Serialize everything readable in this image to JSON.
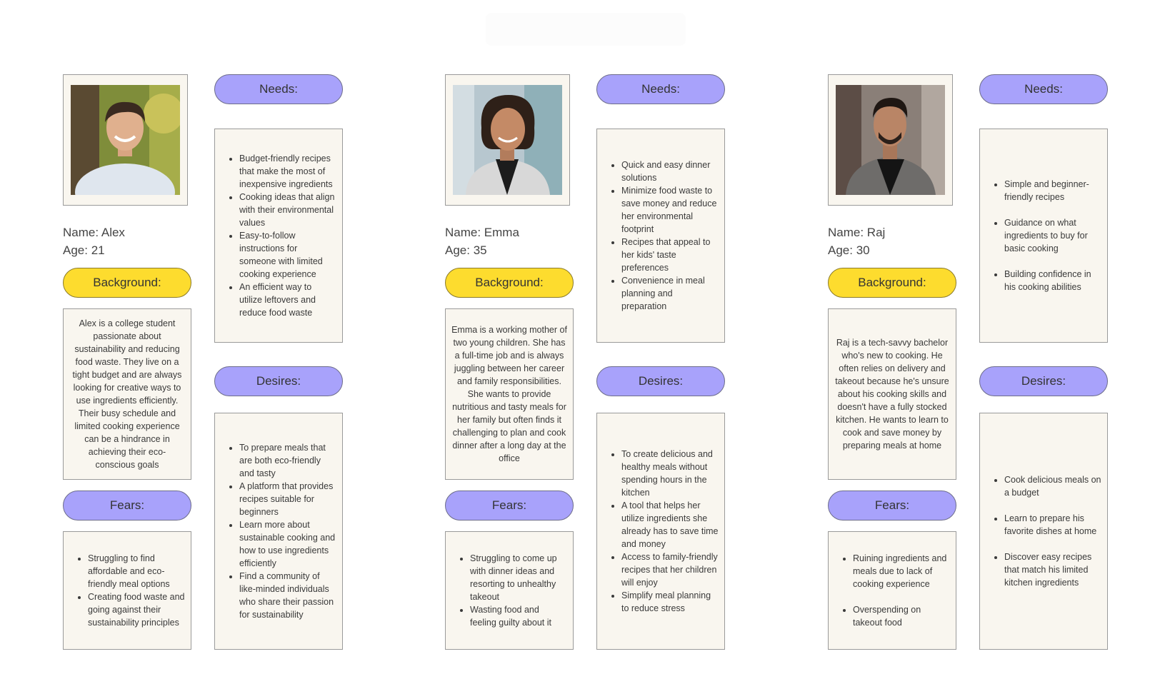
{
  "labels": {
    "needs": "Needs:",
    "desires": "Desires:",
    "background": "Background:",
    "fears": "Fears:"
  },
  "colors": {
    "accent_purple": "#a8a2fb",
    "accent_yellow": "#fddc2e",
    "card_bg": "#f9f6ef"
  },
  "personas": [
    {
      "name": "Name: Alex",
      "age": "Age: 21",
      "photo": "alex-portrait",
      "background": "Alex is a college student passionate about sustainability and reducing food waste. They live on a tight budget and are always looking for creative ways to use ingredients efficiently. Their busy schedule and limited cooking experience can be a hindrance in achieving their eco-conscious goals",
      "needs": [
        "Budget-friendly recipes that make the most of inexpensive ingredients",
        "Cooking ideas that align with their environmental values",
        "Easy-to-follow instructions for someone with limited cooking experience",
        "An efficient way to utilize leftovers and reduce food waste"
      ],
      "desires": [
        "To prepare meals that are both eco-friendly and tasty",
        "A platform that provides recipes suitable for beginners",
        "Learn more about sustainable cooking and how to use ingredients efficiently",
        "Find a community of like-minded individuals who share their passion for sustainability"
      ],
      "fears": [
        "Struggling to find affordable and eco-friendly meal options",
        "Creating food waste and going against their sustainability principles"
      ]
    },
    {
      "name": "Name: Emma",
      "age": "Age: 35",
      "photo": "emma-portrait",
      "background": "Emma is a working mother of two young children. She has a full-time job and is always juggling between her career and family responsibilities. She wants to provide nutritious and tasty meals for her family but often finds it challenging to plan and cook dinner after a long day at the office",
      "needs": [
        "Quick and easy dinner solutions",
        "Minimize food waste to save money and reduce her environmental footprint",
        "Recipes that appeal to her kids' taste preferences",
        "Convenience in meal planning and preparation"
      ],
      "desires": [
        "To create delicious and healthy meals without spending hours in the kitchen",
        "A tool that helps her utilize ingredients she already has to save time and money",
        "Access to family-friendly recipes that her children will enjoy",
        "Simplify meal planning to reduce stress"
      ],
      "fears": [
        "Struggling to come up with dinner ideas and resorting to unhealthy takeout",
        "Wasting food and feeling guilty about it"
      ]
    },
    {
      "name": "Name: Raj",
      "age": "Age: 30",
      "photo": "raj-portrait",
      "background": "Raj is a tech-savvy bachelor who's new to cooking. He often relies on delivery and takeout because he's unsure about his cooking skills and doesn't have a fully stocked kitchen. He wants to learn to cook and save money by preparing meals at home",
      "needs": [
        "Simple and beginner-friendly recipes",
        "Guidance on what ingredients to buy for basic cooking",
        "Building confidence in his cooking abilities"
      ],
      "desires": [
        "Cook delicious meals on a budget",
        "Learn to prepare his favorite dishes at home",
        "Discover easy recipes that match his limited kitchen ingredients"
      ],
      "fears": [
        "Ruining ingredients and meals due to lack of cooking experience",
        "Overspending on takeout food"
      ]
    }
  ]
}
